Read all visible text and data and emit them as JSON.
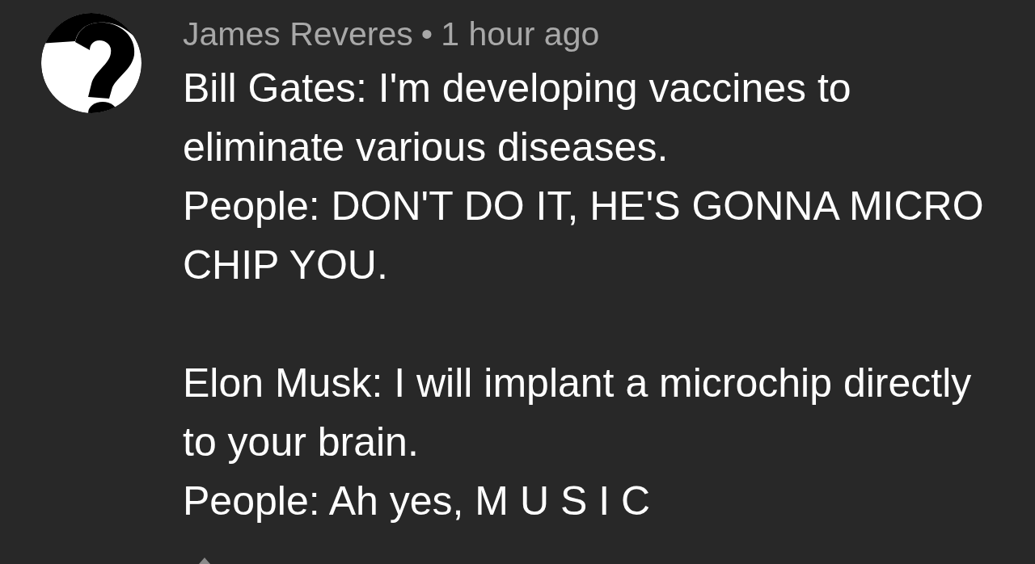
{
  "comment": {
    "author": "James Reveres",
    "separator": "•",
    "time": "1 hour ago",
    "paragraphs": [
      [
        "Bill Gates: I'm developing vaccines to eliminate various diseases.",
        "People: DON'T DO IT, HE'S GONNA MICRO CHIP YOU."
      ],
      [
        "Elon Musk: I will implant a microchip directly to your brain.",
        "People: Ah yes, M U S I C"
      ]
    ]
  }
}
